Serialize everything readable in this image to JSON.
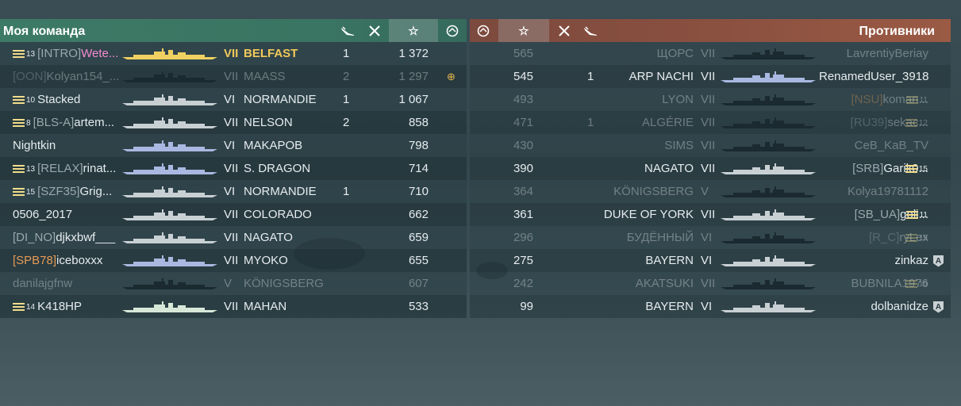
{
  "left": {
    "title": "Моя команда",
    "header_icons": {
      "planes": "plane-kill-icon",
      "frags": "ship-kill-icon",
      "xp": "☆",
      "dogtag": "dogtag-icon"
    },
    "rows": [
      {
        "rank": "13",
        "clan": "[INTRO]",
        "name": "Wete...",
        "name_style": "pink",
        "tier": "VII",
        "ship": "BELFAST",
        "ship_style": "gold",
        "kills": "1",
        "xp": "1 372",
        "dead": false,
        "award": false,
        "ship_color": "#f0d060"
      },
      {
        "rank": "",
        "clan": "[OON]",
        "name": "Kolyan154_...",
        "tier": "VII",
        "ship": "MAASS",
        "kills": "2",
        "xp": "1 297",
        "dead": true,
        "award": true,
        "ship_color": "#1a2a30"
      },
      {
        "rank": "10",
        "clan": "",
        "name": "Stacked",
        "tier": "VI",
        "ship": "NORMANDIE",
        "kills": "1",
        "xp": "1 067",
        "dead": false,
        "award": false,
        "ship_color": "#c8d0d4"
      },
      {
        "rank": "8",
        "clan": "[BLS-A]",
        "name": "artem...",
        "tier": "VII",
        "ship": "NELSON",
        "kills": "2",
        "xp": "858",
        "dead": false,
        "award": false,
        "ship_color": "#c8d0d4"
      },
      {
        "rank": "",
        "clan": "",
        "name": "Nightkin",
        "tier": "VI",
        "ship": "MAKAPOB",
        "kills": "",
        "xp": "798",
        "dead": false,
        "award": false,
        "ship_color": "#a8b8e0"
      },
      {
        "rank": "13",
        "clan": "[RELAX]",
        "name": "rinat...",
        "tier": "VII",
        "ship": "S. DRAGON",
        "kills": "",
        "xp": "714",
        "dead": false,
        "award": false,
        "ship_color": "#a8b8e0"
      },
      {
        "rank": "15",
        "clan": "[SZF35]",
        "name": "Grig...",
        "tier": "VI",
        "ship": "NORMANDIE",
        "kills": "1",
        "xp": "710",
        "dead": false,
        "award": false,
        "ship_color": "#c8d0d4"
      },
      {
        "rank": "",
        "clan": "",
        "name": "0506_2017",
        "tier": "VII",
        "ship": "COLORADO",
        "kills": "",
        "xp": "662",
        "dead": false,
        "award": false,
        "ship_color": "#c8d0d4"
      },
      {
        "rank": "",
        "clan": "[DI_NO]",
        "name": "djkxbwf___",
        "tier": "VII",
        "ship": "NAGATO",
        "kills": "",
        "xp": "659",
        "dead": false,
        "award": false,
        "ship_color": "#c8d0d4"
      },
      {
        "rank": "",
        "clan": "[SPB78]",
        "clan_style": "orange",
        "name": "iceboxxx",
        "tier": "VII",
        "ship": "MYOKO",
        "kills": "",
        "xp": "655",
        "dead": false,
        "award": false,
        "ship_color": "#a8b8e0"
      },
      {
        "rank": "",
        "clan": "",
        "name": "danilajgfnw",
        "tier": "V",
        "ship": "KÖNIGSBERG",
        "kills": "",
        "xp": "607",
        "dead": true,
        "award": false,
        "ship_color": "#1a2a30"
      },
      {
        "rank": "14",
        "clan": "",
        "name": "K418HP",
        "tier": "VII",
        "ship": "MAHAN",
        "kills": "",
        "xp": "533",
        "dead": false,
        "award": false,
        "ship_color": "#d8e8d8"
      }
    ]
  },
  "right": {
    "title": "Противники",
    "header_icons": {
      "dogtag": "dogtag-icon",
      "xp": "☆",
      "frags": "ship-kill-icon",
      "planes": "plane-kill-icon"
    },
    "rows": [
      {
        "xp": "565",
        "kills": "",
        "ship": "ЩОРС",
        "tier": "VII",
        "clan": "",
        "name": "LavrentiyBeriay",
        "rank": "",
        "bot": false,
        "dead": true,
        "ship_color": "#1a2a30"
      },
      {
        "xp": "545",
        "kills": "1",
        "ship": "ARP NACHI",
        "tier": "VII",
        "clan": "",
        "name": "RenamedUser_3918",
        "rank": "",
        "bot": false,
        "dead": false,
        "ship_color": "#a8b8e0"
      },
      {
        "xp": "493",
        "kills": "",
        "ship": "LYON",
        "tier": "VII",
        "clan": "[NSU]",
        "clan_style": "orange",
        "name": "koman...",
        "rank": "11",
        "bot": false,
        "dead": true,
        "ship_color": "#1a2a30"
      },
      {
        "xp": "471",
        "kills": "1",
        "ship": "ALGÉRIE",
        "tier": "VII",
        "clan": "[RU39]",
        "name": "sekac...",
        "rank": "12",
        "bot": false,
        "dead": true,
        "ship_color": "#1a2a30"
      },
      {
        "xp": "430",
        "kills": "",
        "ship": "SIMS",
        "tier": "VII",
        "clan": "",
        "name": "CeB_KaB_TV",
        "rank": "",
        "bot": false,
        "dead": true,
        "ship_color": "#1a2a30"
      },
      {
        "xp": "390",
        "kills": "",
        "ship": "NAGATO",
        "tier": "VII",
        "clan": "[SRB]",
        "name": "Garik0...",
        "rank": "15",
        "bot": false,
        "dead": false,
        "ship_color": "#c8d0d4"
      },
      {
        "xp": "364",
        "kills": "",
        "ship": "KÖNIGSBERG",
        "tier": "V",
        "clan": "",
        "name": "Kolya19781112",
        "rank": "",
        "bot": false,
        "dead": true,
        "ship_color": "#1a2a30"
      },
      {
        "xp": "361",
        "kills": "",
        "ship": "DUKE OF YORK",
        "tier": "VII",
        "clan": "[SB_UA]",
        "name": "goli...",
        "rank": "11",
        "bot": false,
        "dead": false,
        "ship_color": "#c8d0d4"
      },
      {
        "xp": "296",
        "kills": "",
        "ship": "БУДЁННЫЙ",
        "tier": "VI",
        "clan": "[R_C]",
        "name": "ryLex",
        "rank": "15",
        "bot": false,
        "dead": true,
        "ship_color": "#1a2a30"
      },
      {
        "xp": "275",
        "kills": "",
        "ship": "BAYERN",
        "tier": "VI",
        "clan": "",
        "name": "zinkaz",
        "rank": "",
        "bot": true,
        "dead": false,
        "ship_color": "#c8d0d4"
      },
      {
        "xp": "242",
        "kills": "",
        "ship": "AKATSUKI",
        "tier": "VII",
        "clan": "",
        "name": "BUBNILA1976",
        "rank": "19",
        "bot": false,
        "dead": true,
        "ship_color": "#1a2a30"
      },
      {
        "xp": "99",
        "kills": "",
        "ship": "BAYERN",
        "tier": "VI",
        "clan": "",
        "name": "dolbanidze",
        "rank": "",
        "bot": true,
        "dead": false,
        "ship_color": "#c8d0d4"
      }
    ]
  }
}
